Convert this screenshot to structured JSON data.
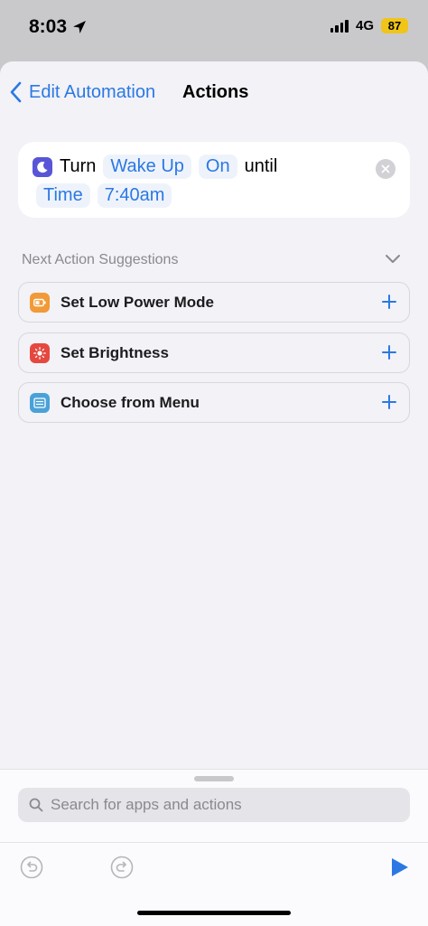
{
  "status_bar": {
    "time": "8:03",
    "network": "4G",
    "battery": "87",
    "location_icon": "location-arrow-icon"
  },
  "nav": {
    "back_label": "Edit Automation",
    "title": "Actions"
  },
  "action": {
    "verb": "Turn",
    "focus_value": "Wake Up",
    "state_value": "On",
    "connector": "until",
    "condition_value": "Time",
    "time_value": "7:40am",
    "icon": "moon-icon",
    "icon_color": "#5856d6"
  },
  "suggestions": {
    "header": "Next Action Suggestions",
    "items": [
      {
        "label": "Set Low Power Mode",
        "icon": "battery-icon",
        "color": "#f19a37"
      },
      {
        "label": "Set Brightness",
        "icon": "brightness-icon",
        "color": "#e5483f"
      },
      {
        "label": "Choose from Menu",
        "icon": "menu-icon",
        "color": "#4aa1d8"
      }
    ]
  },
  "search": {
    "placeholder": "Search for apps and actions"
  },
  "colors": {
    "accent": "#2b78e4",
    "battery_badge": "#f0c419"
  }
}
